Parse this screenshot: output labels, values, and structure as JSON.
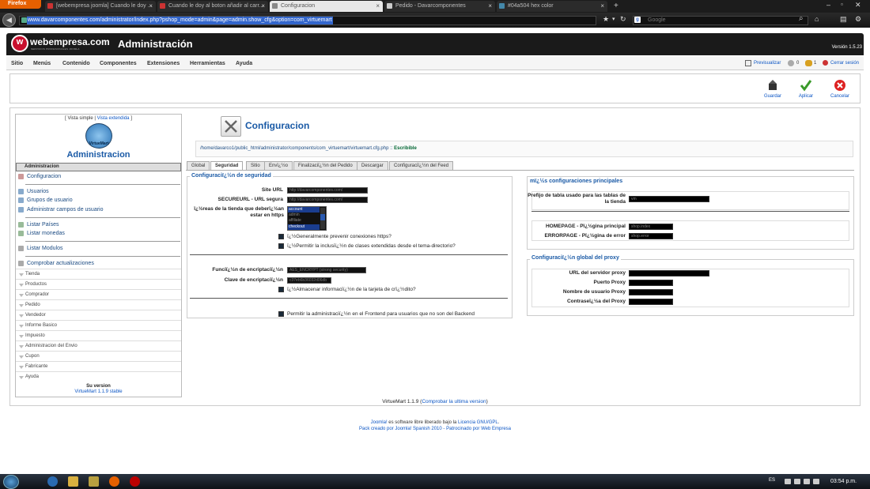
{
  "browser": {
    "menu_button": "Firefox",
    "tabs": [
      {
        "title": "[webempresa joomla] Cuando le doy ...",
        "active": false
      },
      {
        "title": "Cuando le doy al boton añadir al carr...",
        "active": false
      },
      {
        "title": "Configuracion",
        "active": true
      },
      {
        "title": "Pedido - Davarcomponentes",
        "active": false
      },
      {
        "title": "#04a504 hex color",
        "active": false
      }
    ],
    "url": "www.davarcomponentes.com/administrator/index.php?pshop_mode=admin&page=admin.show_cfg&option=com_virtuemart",
    "search_placeholder": "Google"
  },
  "header": {
    "logo_text": "webempresa.com",
    "logo_subtitle": "SERVICIOS PROFESIONALES JOOMLA",
    "title": "Administración",
    "version": "Versión 1.5.23"
  },
  "menu": {
    "items": [
      "Sitio",
      "Menús",
      "Contenido",
      "Componentes",
      "Extensiones",
      "Herramientas",
      "Ayuda"
    ],
    "preview": "Previsualizar",
    "messages_count": "0",
    "users_count": "1",
    "logout": "Cerrar sesión"
  },
  "toolbar": {
    "save": "Guardar",
    "apply": "Aplicar",
    "cancel": "Cancelar"
  },
  "left": {
    "view_simple": "[ Vista simple |",
    "view_extended": "Vista extendida",
    "view_close": "]",
    "logo_label": "VirtueMart",
    "title": "Administracion",
    "section_admin": "Administracion",
    "item_config": "Configuracion",
    "item_users": "Usuarios",
    "item_groups": "Grupos de usuario",
    "item_fields": "Administrar campos de usuario",
    "item_countries": "Listar Países",
    "item_currencies": "Listar monedas",
    "item_modules": "Listar Modulos",
    "item_updates": "Comprobar actualizaciones",
    "sections": [
      "Tienda",
      "Productos",
      "Comprador",
      "Pedido",
      "Vendedor",
      "Informe Basico",
      "Impuesto",
      "Administracion del Envio",
      "Cupon",
      "Fabricante",
      "Ayuda"
    ],
    "version_label": "Su version",
    "version_value": "VirtueMart 1.1.9 stable"
  },
  "main": {
    "title": "Configuracion",
    "path": "/home/davarco1/public_html/administrator/components/com_virtuemart/virtuemart.cfg.php :: ",
    "path_status": "Escribible",
    "tabs": [
      "Global",
      "Seguridad",
      "Sitio",
      "Envï¿½o",
      "Finalizaciï¿½n del Pedido",
      "Descargar",
      "Configuraciï¿½n del Feed"
    ],
    "active_tab": "Seguridad"
  },
  "security": {
    "title": "Configuraciï¿½n de seguridad",
    "site_url_label": "Site URL",
    "site_url_value": "http://davarcomponentes.com/",
    "secure_url_label": "SECUREURL - URL segura",
    "secure_url_value": "http://davarcomponentes.com/",
    "areas_label": "ï¿½reas de la tienda que deberï¿½an estar en https",
    "areas_options": [
      "account",
      "admin",
      "affiliate",
      "checkout"
    ],
    "chk_prevent": "ï¿½Generalmente prevenir conexiones https?",
    "chk_allow": "ï¿½Permitir la inclusiï¿½n de clases extendidas desde el tema-directorio?",
    "enc_func_label": "Funciï¿½n de encriptaciï¿½n",
    "enc_func_value": "AES_ENCRYPT (strong security)",
    "enc_key_label": "Clave de encriptaciï¿½n",
    "enc_key_value": "c37eb6b36032d06db",
    "chk_store_cc": "ï¿½Almacenar informaciï¿½n de la tarjeta de crï¿½dito?",
    "chk_frontend": "Permitir la administraciï¿½n en el Frontend para usuarios que no son del Backend"
  },
  "main_config": {
    "title": "mï¿½s configuraciones principales",
    "table_prefix_label": "Prefijo de tabla usado para las tablas de la tienda",
    "table_prefix_value": "vm",
    "homepage_label": "HOMEPAGE - Pï¿½gina principal",
    "homepage_value": "shop.index",
    "errorpage_label": "ERRORPAGE - Pï¿½gina de error",
    "errorpage_value": "shop.error"
  },
  "proxy": {
    "title": "Configuraciï¿½n global del proxy",
    "url_label": "URL del servidor proxy",
    "port_label": "Puerto Proxy",
    "user_label": "Nombre de usuario Proxy",
    "pass_label": "Contraseï¿½a del Proxy"
  },
  "footer": {
    "vm_version": "VirtueMart 1.1.9 (",
    "vm_check": "Comprobar la ultima version",
    "vm_close": ")",
    "joomla_link": "Joomla!",
    "joomla_text": " es software libre liberado bajo la ",
    "license_link": "Licencia GNU/GPL",
    "license_end": ".",
    "pack_line": "Pack creado por Joomla! Spanish 2010 - Patrocinado por Web Empresa"
  },
  "taskbar": {
    "lang": "ES",
    "time": "03:54 p.m."
  },
  "colors": {
    "link": "#0b55c4",
    "heading": "#1a5aa6",
    "header_bg": "#1a1a1a",
    "brand_red": "#c8102e"
  }
}
